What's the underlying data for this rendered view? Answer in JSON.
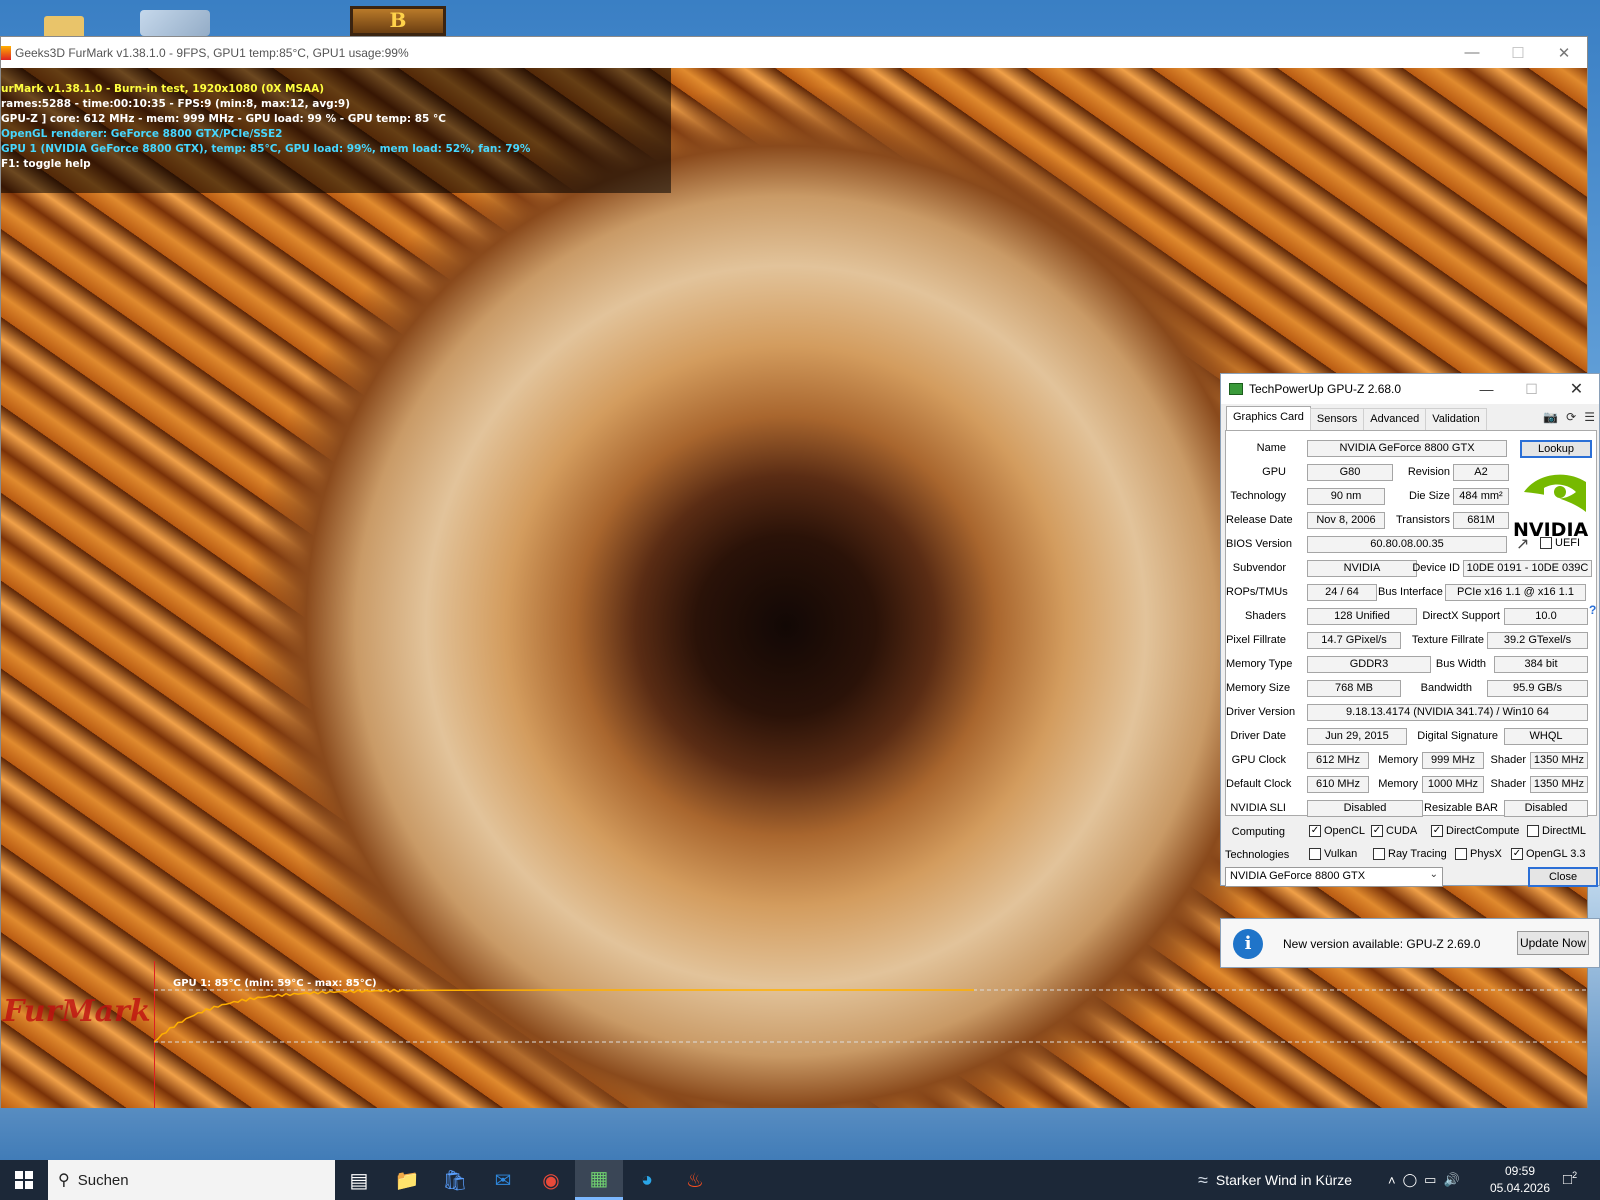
{
  "desktop": {
    "game_icon_letter": "B"
  },
  "furmark": {
    "title": "Geeks3D FurMark v1.38.1.0 - 9FPS, GPU1 temp:85°C, GPU1 usage:99%",
    "hud": [
      "urMark v1.38.1.0 - Burn-in test, 1920x1080 (0X MSAA)",
      "rames:5288 - time:00:10:35 - FPS:9 (min:8, max:12, avg:9)",
      "GPU-Z ] core: 612 MHz - mem: 999 MHz - GPU load: 99 % - GPU temp: 85 °C",
      " OpenGL renderer: GeForce 8800 GTX/PCIe/SSE2",
      " GPU 1 (NVIDIA GeForce 8800 GTX), temp: 85°C, GPU load: 99%, mem load: 52%, fan: 79%",
      "F1: toggle help"
    ],
    "graph": {
      "label": "GPU 1: 85°C (min: 59°C - max: 85°C)",
      "current_temp": 85,
      "min_temp": 59,
      "max_temp": 85,
      "line_color": "#ffb000"
    },
    "logo_text": "FurMark"
  },
  "gpuz": {
    "title": "TechPowerUp GPU-Z 2.68.0",
    "tabs": [
      "Graphics Card",
      "Sensors",
      "Advanced",
      "Validation"
    ],
    "active_tab": "Graphics Card",
    "lookup_label": "Lookup",
    "brand_text": "NVIDIA",
    "uefi_label": "UEFI",
    "fields": {
      "name_label": "Name",
      "name": "NVIDIA GeForce 8800 GTX",
      "gpu_label": "GPU",
      "gpu": "G80",
      "revision_label": "Revision",
      "revision": "A2",
      "technology_label": "Technology",
      "technology": "90 nm",
      "die_size_label": "Die Size",
      "die_size": "484 mm²",
      "release_date_label": "Release Date",
      "release_date": "Nov 8, 2006",
      "transistors_label": "Transistors",
      "transistors": "681M",
      "bios_label": "BIOS Version",
      "bios": "60.80.08.00.35",
      "subvendor_label": "Subvendor",
      "subvendor": "NVIDIA",
      "device_id_label": "Device ID",
      "device_id": "10DE 0191 - 10DE 039C",
      "rops_label": "ROPs/TMUs",
      "rops": "24 / 64",
      "bus_label": "Bus Interface",
      "bus": "PCIe x16 1.1 @ x16 1.1",
      "shaders_label": "Shaders",
      "shaders": "128 Unified",
      "directx_label": "DirectX Support",
      "directx": "10.0",
      "pixel_label": "Pixel Fillrate",
      "pixel": "14.7 GPixel/s",
      "texture_label": "Texture Fillrate",
      "texture": "39.2 GTexel/s",
      "memtype_label": "Memory Type",
      "memtype": "GDDR3",
      "buswidth_label": "Bus Width",
      "buswidth": "384 bit",
      "memsize_label": "Memory Size",
      "memsize": "768 MB",
      "bandwidth_label": "Bandwidth",
      "bandwidth": "95.9 GB/s",
      "driver_label": "Driver Version",
      "driver": "9.18.13.4174 (NVIDIA 341.74) / Win10 64",
      "driverdate_label": "Driver Date",
      "driverdate": "Jun 29, 2015",
      "signature_label": "Digital Signature",
      "signature": "WHQL",
      "gpuclock_label": "GPU Clock",
      "gpuclock": "612 MHz",
      "memory_label": "Memory",
      "memclock": "999 MHz",
      "shader_label": "Shader",
      "shaderclock": "1350 MHz",
      "defclock_label": "Default Clock",
      "defclock": "610 MHz",
      "defmem": "1000 MHz",
      "defshader": "1350 MHz",
      "sli_label": "NVIDIA SLI",
      "sli": "Disabled",
      "rebar_label": "Resizable BAR",
      "rebar": "Disabled",
      "computing_label": "Computing",
      "technologies_label": "Technologies"
    },
    "computing": [
      {
        "label": "OpenCL",
        "checked": true
      },
      {
        "label": "CUDA",
        "checked": true
      },
      {
        "label": "DirectCompute",
        "checked": true
      },
      {
        "label": "DirectML",
        "checked": false
      }
    ],
    "technologies": [
      {
        "label": "Vulkan",
        "checked": false
      },
      {
        "label": "Ray Tracing",
        "checked": false
      },
      {
        "label": "PhysX",
        "checked": false
      },
      {
        "label": "OpenGL 3.3",
        "checked": true
      }
    ],
    "selected_gpu": "NVIDIA GeForce 8800 GTX",
    "close_label": "Close",
    "accent_color": "#2b6fd6"
  },
  "update": {
    "text": "New version available: GPU-Z 2.69.0",
    "button": "Update Now"
  },
  "taskbar": {
    "search_placeholder": "Suchen",
    "weather": "Starker Wind in Kürze",
    "time": "09:59",
    "date": "05.04.2026",
    "notification_count": "2"
  }
}
